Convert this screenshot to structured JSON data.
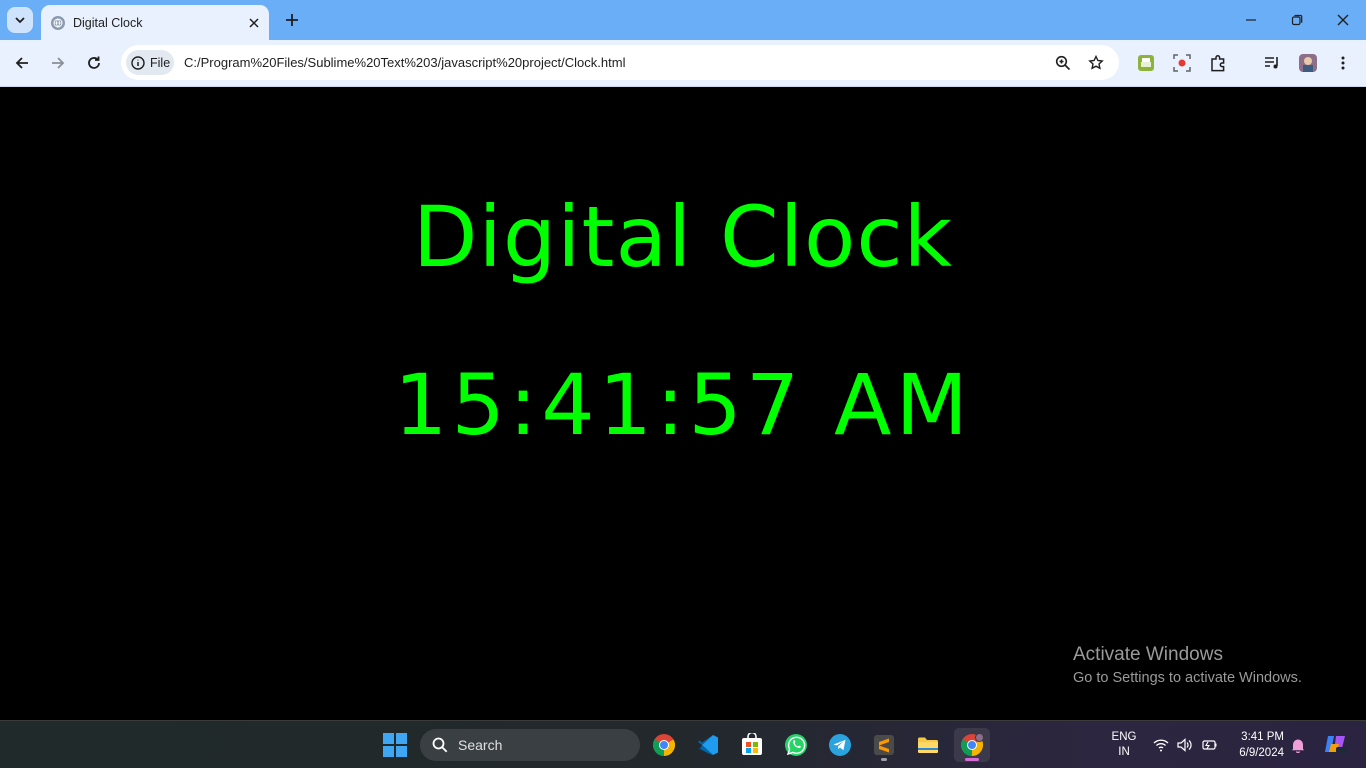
{
  "browser": {
    "tab_title": "Digital Clock",
    "chip_label": "File",
    "url": "C:/Program%20Files/Sublime%20Text%203/javascript%20project/Clock.html"
  },
  "page": {
    "heading": "Digital Clock",
    "time": "15:41:57 AM",
    "text_color": "#00ff00",
    "background": "#000000"
  },
  "watermark": {
    "line1": "Activate Windows",
    "line2": "Go to Settings to activate Windows."
  },
  "taskbar": {
    "search_placeholder": "Search",
    "apps": [
      "chrome-icon",
      "vscode-icon",
      "store-icon",
      "whatsapp-icon",
      "telegram-icon",
      "sublime-text-icon",
      "file-explorer-icon",
      "chrome-profile-icon"
    ],
    "lang_line1": "ENG",
    "lang_line2": "IN",
    "time": "3:41 PM",
    "date": "6/9/2024"
  }
}
